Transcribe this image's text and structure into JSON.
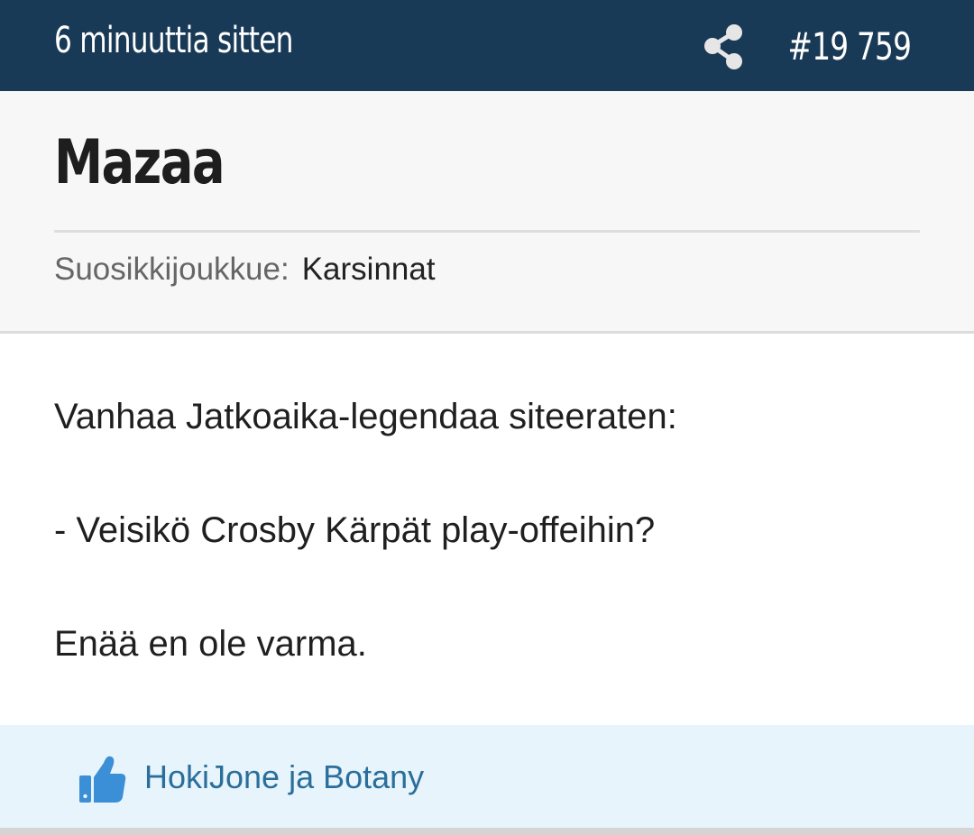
{
  "topbar": {
    "time_ago": "6 minuuttia sitten",
    "share_icon": "share-icon",
    "post_number": "#19 759"
  },
  "post": {
    "username": "Mazaa",
    "favorite_team_label": "Suosikkijoukkue:",
    "favorite_team_value": "Karsinnat",
    "lines": [
      "Vanhaa Jatkoaika-legendaa siteeraten:",
      "- Veisikö Crosby Kärpät play-offeihin?",
      "Enää en ole varma."
    ]
  },
  "likes": {
    "icon": "thumbs-up-icon",
    "text": "HokiJone ja Botany"
  },
  "colors": {
    "topbar_bg": "#193a56",
    "likes_bg": "#e8f4fc",
    "likes_text": "#2a6f9b",
    "thumb_icon": "#3b8fd6"
  }
}
